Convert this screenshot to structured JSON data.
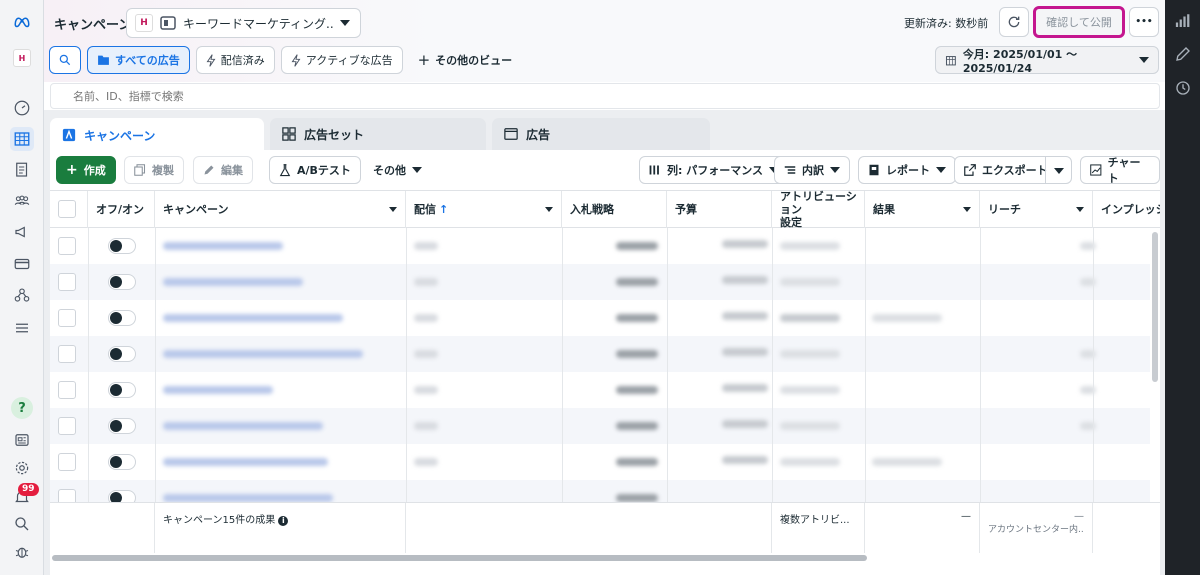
{
  "header": {
    "title": "キャンペーン",
    "account": "キーワードマーケティング...",
    "updated_text": "更新済み: 数秒前",
    "publish_label": "確認して公開",
    "more_label": "•••",
    "date_range": "今月: 2025/01/01 〜 2025/01/24"
  },
  "views": [
    {
      "label": "すべての広告",
      "icon": "folder-icon"
    },
    {
      "label": "配信済み",
      "icon": "bolt-icon"
    },
    {
      "label": "アクティブな広告",
      "icon": "bolt-icon"
    },
    {
      "label": "その他のビュー",
      "icon": "plus-icon"
    }
  ],
  "search": {
    "placeholder": "名前、ID、指標で検索"
  },
  "tabs": [
    {
      "label": "キャンペーン"
    },
    {
      "label": "広告セット"
    },
    {
      "label": "広告"
    }
  ],
  "toolbar": {
    "create": "作成",
    "duplicate": "複製",
    "edit": "編集",
    "ab_test": "A/Bテスト",
    "other": "その他",
    "columns": "列: パフォーマンス",
    "breakdown": "内訳",
    "report": "レポート",
    "export": "エクスポート",
    "chart": "チャート"
  },
  "table": {
    "headers": {
      "onoff": "オフ/オン",
      "campaign": "キャンペーン",
      "delivery": "配信",
      "bid": "入札戦略",
      "budget": "予算",
      "attr1": "アトリビューション",
      "attr2": "設定",
      "results": "結果",
      "reach": "リーチ",
      "impressions": "インプレッショ"
    },
    "summary": {
      "label": "キャンペーン15件の成果",
      "attribution": "複数アトリビ...",
      "results": "—",
      "reach": "—",
      "reach_note": "アカウントセンター内..."
    }
  },
  "nav": {
    "badge": "99"
  },
  "colors": {
    "accent": "#1b74e4",
    "create": "#1a7d3e",
    "highlight": "#c4168f"
  }
}
